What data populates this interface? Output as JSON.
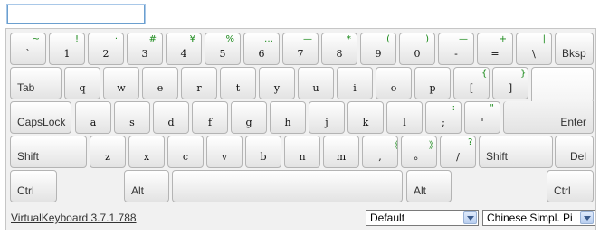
{
  "input": {
    "value": "",
    "placeholder": ""
  },
  "rows": [
    [
      {
        "main": "`",
        "shift": "~"
      },
      {
        "main": "1",
        "shift": "!"
      },
      {
        "main": "2",
        "shift": "·"
      },
      {
        "main": "3",
        "shift": "#"
      },
      {
        "main": "4",
        "shift": "¥"
      },
      {
        "main": "5",
        "shift": "%"
      },
      {
        "main": "6",
        "shift": "…"
      },
      {
        "main": "7",
        "shift": "—"
      },
      {
        "main": "8",
        "shift": "*"
      },
      {
        "main": "9",
        "shift": "("
      },
      {
        "main": "0",
        "shift": ")"
      },
      {
        "main": "-",
        "shift": "—"
      },
      {
        "main": "=",
        "shift": "+"
      },
      {
        "main": "\\",
        "shift": "|"
      }
    ],
    [
      {
        "main": "q"
      },
      {
        "main": "w"
      },
      {
        "main": "e"
      },
      {
        "main": "r"
      },
      {
        "main": "t"
      },
      {
        "main": "y"
      },
      {
        "main": "u"
      },
      {
        "main": "i"
      },
      {
        "main": "o"
      },
      {
        "main": "p"
      },
      {
        "main": "[",
        "shift": "{"
      },
      {
        "main": "]",
        "shift": "}"
      }
    ],
    [
      {
        "main": "a"
      },
      {
        "main": "s"
      },
      {
        "main": "d"
      },
      {
        "main": "f"
      },
      {
        "main": "g"
      },
      {
        "main": "h"
      },
      {
        "main": "j"
      },
      {
        "main": "k"
      },
      {
        "main": "l"
      },
      {
        "main": ";",
        "shift": ":"
      },
      {
        "main": "'",
        "shift": "\""
      }
    ],
    [
      {
        "main": "z"
      },
      {
        "main": "x"
      },
      {
        "main": "c"
      },
      {
        "main": "v"
      },
      {
        "main": "b"
      },
      {
        "main": "n"
      },
      {
        "main": "m"
      },
      {
        "main": ",",
        "shift": "《"
      },
      {
        "main": "。",
        "shift": "》"
      },
      {
        "main": "/",
        "shift": "?"
      }
    ]
  ],
  "special": {
    "bksp": "Bksp",
    "tab": "Tab",
    "capslock": "CapsLock",
    "enter": "Enter",
    "shift_left": "Shift",
    "shift_right": "Shift",
    "del": "Del",
    "ctrl_left": "Ctrl",
    "alt_left": "Alt",
    "space": "",
    "alt_right": "Alt",
    "ctrl_right": "Ctrl"
  },
  "footer": {
    "version": "VirtualKeyboard 3.7.1.788",
    "layout_select": "Default",
    "language_select": "Chinese Simpl. Pi"
  },
  "colors": {
    "shift_char": "#1a8a1a",
    "key_border": "#b4b4b4",
    "panel_bg": "#f1f1f1"
  }
}
